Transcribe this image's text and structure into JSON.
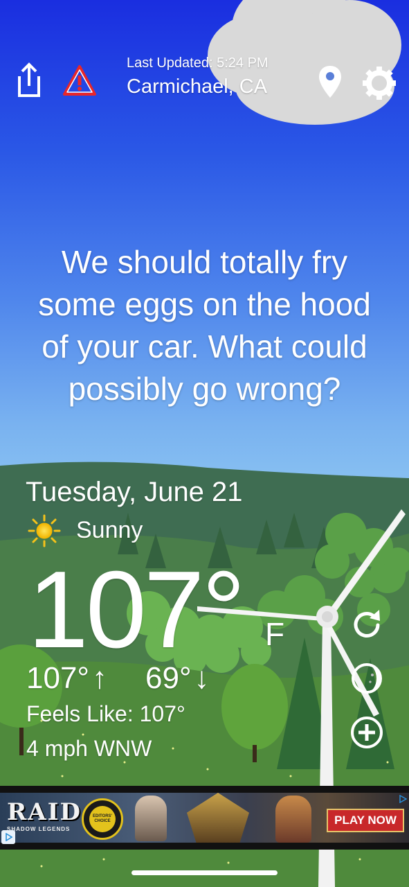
{
  "header": {
    "last_updated": "Last Updated: 5:24 PM",
    "location": "Carmichael, CA"
  },
  "quote": "We should totally fry some eggs on the hood of your car. What could possibly go wrong?",
  "weather": {
    "date": "Tuesday, June 21",
    "condition": "Sunny",
    "temperature": "107°",
    "unit": "F",
    "high": "107°",
    "low": "69°",
    "high_arrow": "↑",
    "low_arrow": "↓",
    "feels_like": "Feels Like: 107°",
    "wind": "4 mph WNW"
  },
  "ad": {
    "brand": "RAID",
    "brand_sub": "SHADOW LEGENDS",
    "badge": "EDITORS' CHOICE",
    "cta": "PLAY NOW"
  },
  "icons": {
    "share": "share-icon",
    "alert": "warning-icon",
    "location": "location-pin-icon",
    "settings": "gear-icon",
    "refresh": "refresh-icon",
    "moon": "moon-phase-icon",
    "add": "add-icon",
    "sun": "sun-icon"
  },
  "colors": {
    "sky_top": "#1a2ee0",
    "alert_red": "#e8262a",
    "grass": "#4f8a3c",
    "cta_red": "#c8282a"
  }
}
